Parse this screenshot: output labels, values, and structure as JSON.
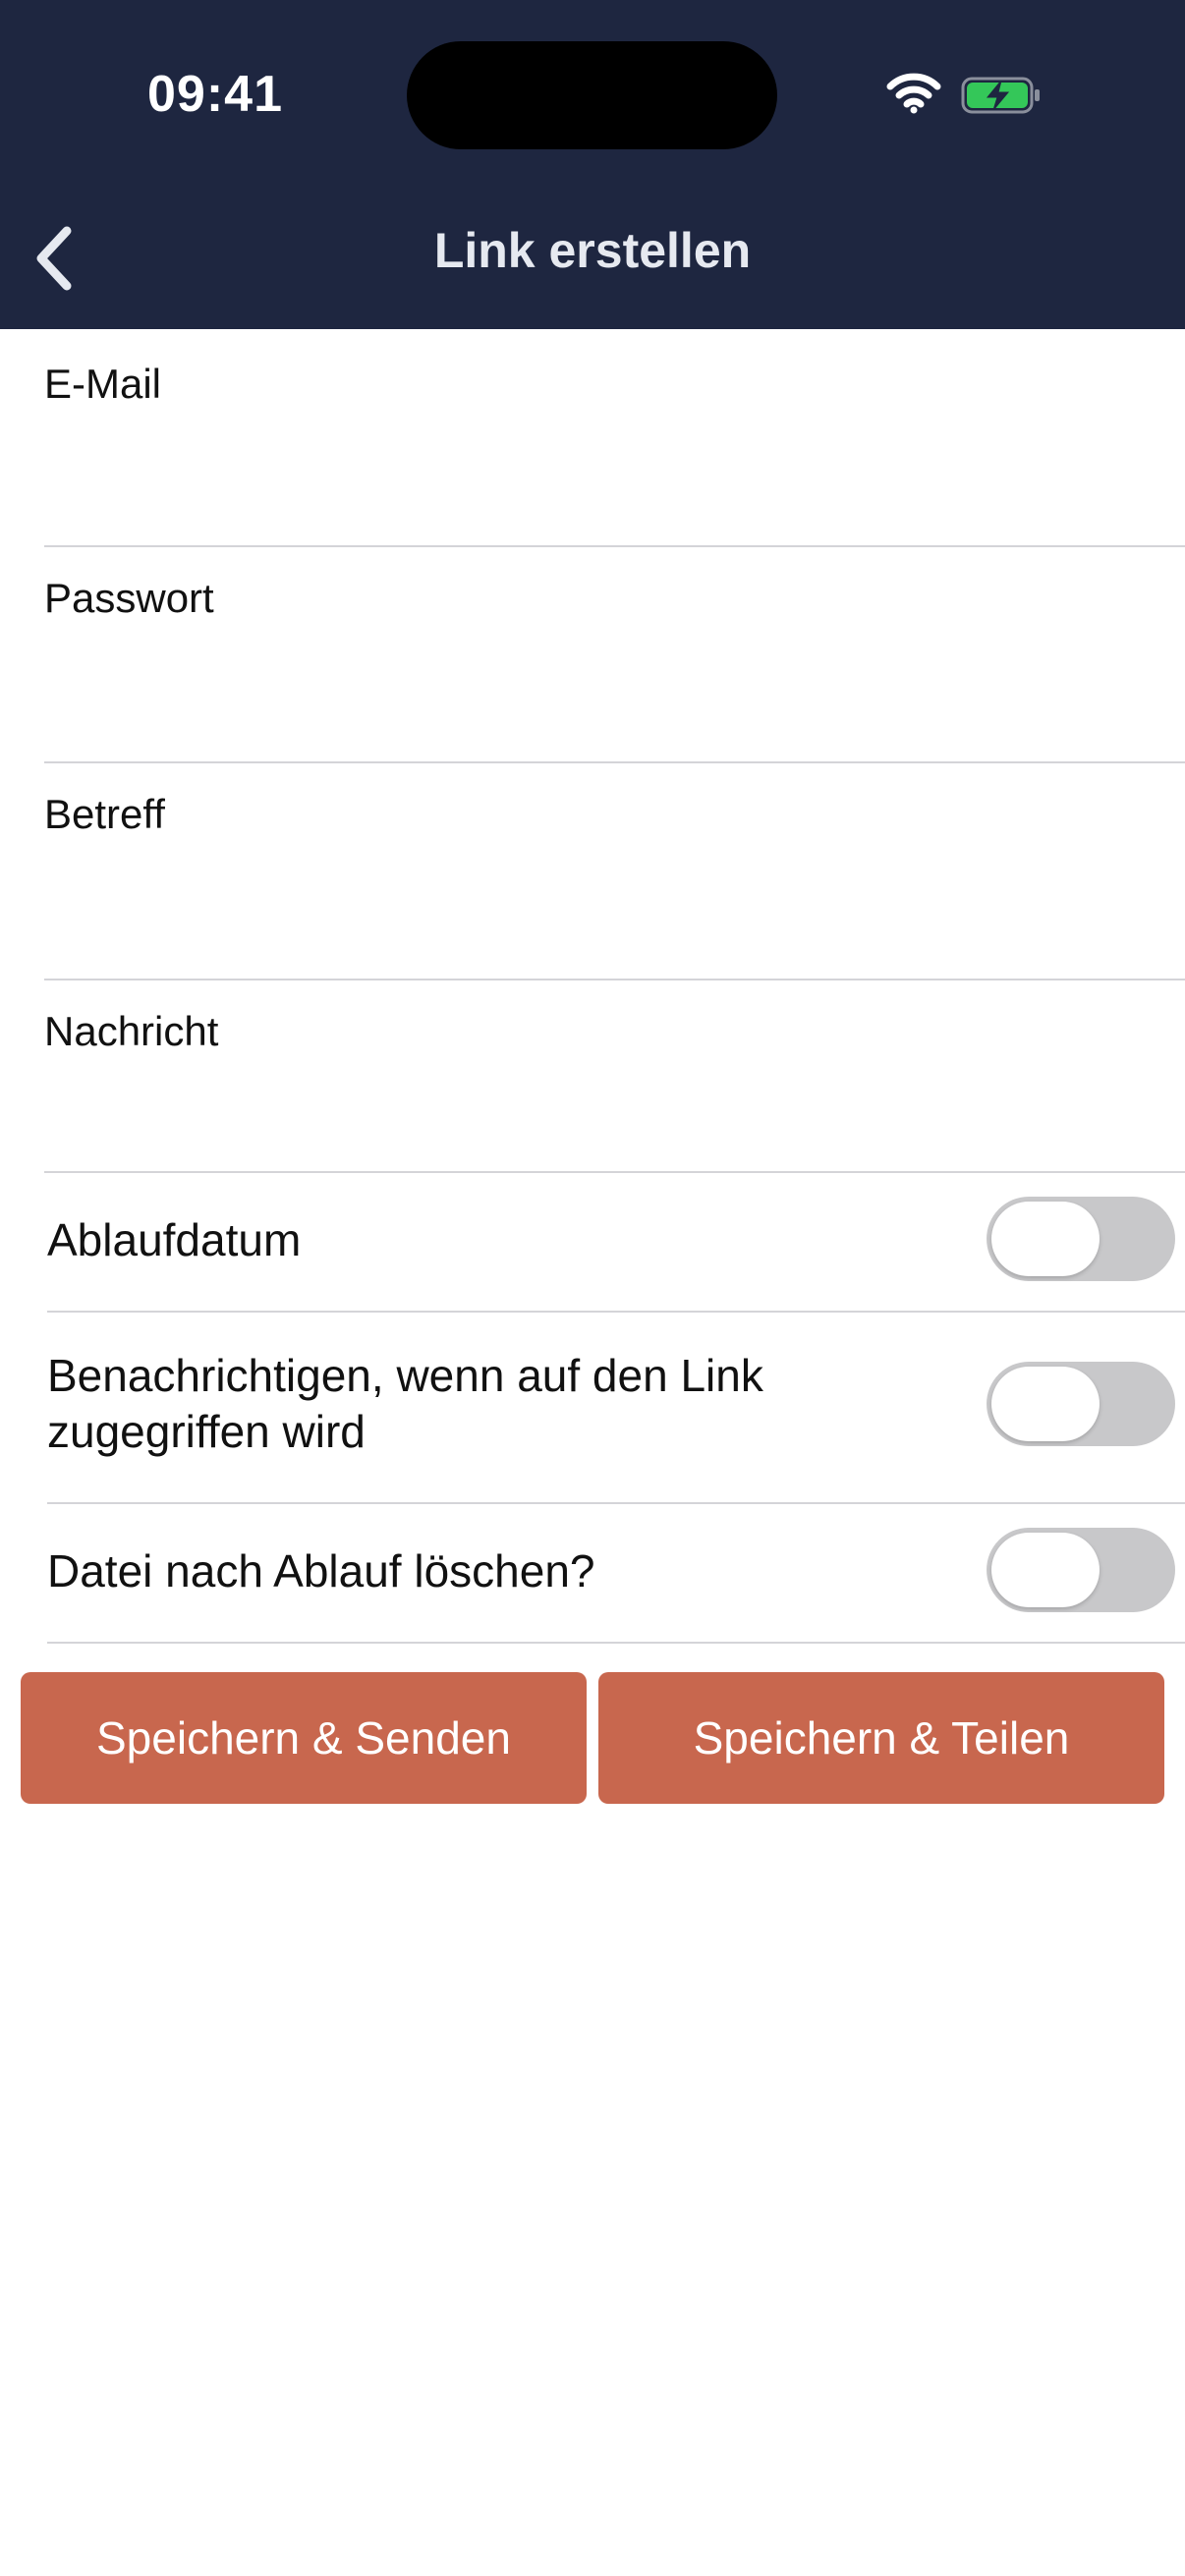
{
  "status_bar": {
    "time": "09:41"
  },
  "nav": {
    "title": "Link erstellen",
    "back_icon": "chevron-left-icon"
  },
  "form": {
    "email_label": "E-Mail",
    "email_value": "",
    "password_label": "Passwort",
    "password_value": "",
    "subject_label": "Betreff",
    "subject_value": "",
    "message_label": "Nachricht",
    "message_value": ""
  },
  "toggles": {
    "expiry_label": "Ablaufdatum",
    "expiry_on": false,
    "notify_line1": "Benachrichtigen, wenn auf den Link",
    "notify_line2": "zugegriffen wird",
    "notify_on": false,
    "delete_label": "Datei nach Ablauf löschen?",
    "delete_on": false
  },
  "actions": {
    "save_send": "Speichern & Senden",
    "save_share": "Speichern & Teilen"
  },
  "colors": {
    "header_bg": "#1e2640",
    "button_bg": "#c8674e",
    "toggle_off": "#c8c8ca",
    "battery_green": "#34c759"
  }
}
